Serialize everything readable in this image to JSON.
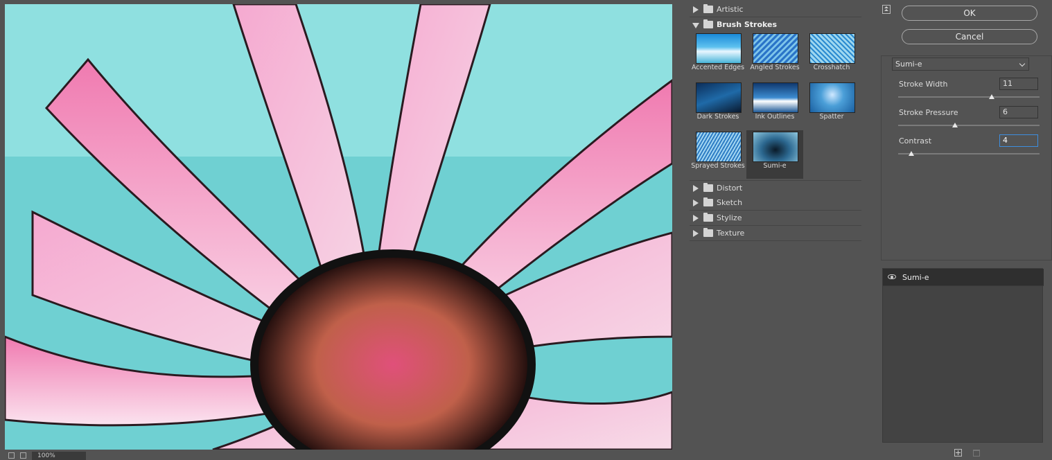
{
  "zoom": {
    "value": "100%"
  },
  "gallery": {
    "categories": [
      {
        "label": "Artistic",
        "open": false
      },
      {
        "label": "Brush Strokes",
        "open": true
      },
      {
        "label": "Distort",
        "open": false
      },
      {
        "label": "Sketch",
        "open": false
      },
      {
        "label": "Stylize",
        "open": false
      },
      {
        "label": "Texture",
        "open": false
      }
    ],
    "brush_strokes": [
      {
        "label": "Accented Edges"
      },
      {
        "label": "Angled Strokes"
      },
      {
        "label": "Crosshatch"
      },
      {
        "label": "Dark Strokes"
      },
      {
        "label": "Ink Outlines"
      },
      {
        "label": "Spatter"
      },
      {
        "label": "Sprayed Strokes"
      },
      {
        "label": "Sumi-e",
        "selected": true
      }
    ]
  },
  "buttons": {
    "ok": "OK",
    "cancel": "Cancel"
  },
  "settings": {
    "filter": "Sumi-e",
    "params": [
      {
        "label": "Stroke Width",
        "value": "11",
        "slider": 0.6
      },
      {
        "label": "Stroke Pressure",
        "value": "6",
        "slider": 0.4
      },
      {
        "label": "Contrast",
        "value": "4",
        "slider": 0.1
      }
    ]
  },
  "layers": [
    {
      "label": "Sumi-e",
      "visible": true
    }
  ],
  "colors": {
    "panel": "#535353",
    "dark": "#3b3b3b",
    "focus": "#3d8ee0"
  }
}
